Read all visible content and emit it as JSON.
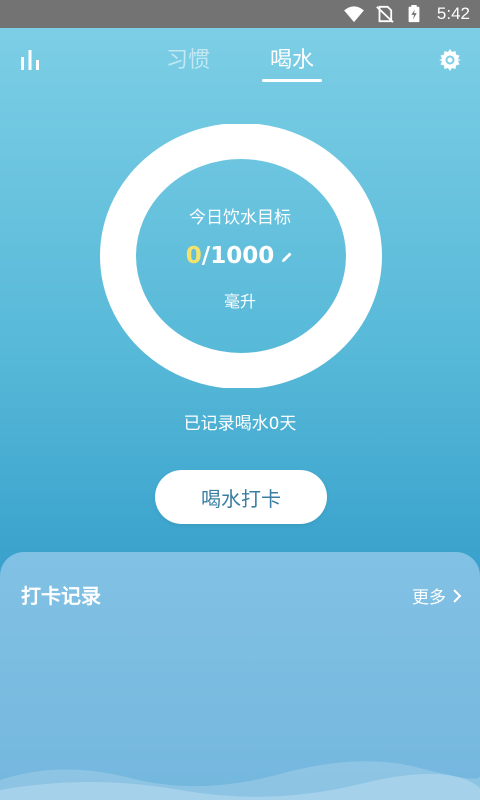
{
  "status_bar": {
    "time": "5:42",
    "icons": [
      "wifi-icon",
      "no-sim-icon",
      "battery-charging-icon"
    ]
  },
  "nav": {
    "stats_icon": "bar-chart-icon",
    "tabs": [
      {
        "label": "习惯",
        "active": false
      },
      {
        "label": "喝水",
        "active": true
      }
    ],
    "settings_icon": "gear-icon"
  },
  "goal": {
    "label": "今日饮水目标",
    "current": "0",
    "separator": "/",
    "target": "1000",
    "unit": "毫升",
    "edit_icon": "pencil-icon"
  },
  "record_days_text": "已记录喝水0天",
  "checkin_button": "喝水打卡",
  "records_card": {
    "title": "打卡记录",
    "more_label": "更多",
    "more_icon": "chevron-right-icon"
  },
  "colors": {
    "accent_value": "#f5e26a",
    "button_text": "#3a7fa3"
  }
}
